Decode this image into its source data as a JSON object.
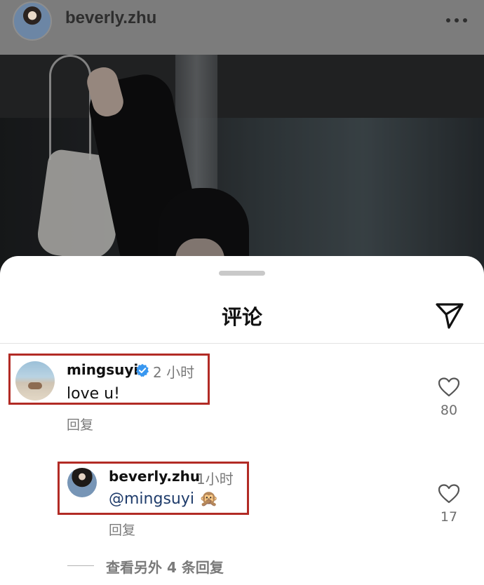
{
  "post": {
    "username": "beverly.zhu",
    "more_icon": "more-horizontal-icon"
  },
  "sheet": {
    "title": "评论",
    "send_icon": "send-paper-plane-icon"
  },
  "comments": [
    {
      "username": "mingsuyi",
      "verified": true,
      "time": "2 小时",
      "text": "love u!",
      "reply_label": "回复",
      "like_count": "80",
      "highlighted": true
    }
  ],
  "replies": [
    {
      "username": "beverly.zhu",
      "time": "1小时",
      "mention": "@mingsuyi",
      "emoji": "🙊",
      "reply_label": "回复",
      "like_count": "17",
      "highlighted": true
    }
  ],
  "view_more": "查看另外 4 条回复",
  "colors": {
    "highlight_border": "#b22b25",
    "mention": "#1f3c6b",
    "verified": "#3897f0"
  }
}
